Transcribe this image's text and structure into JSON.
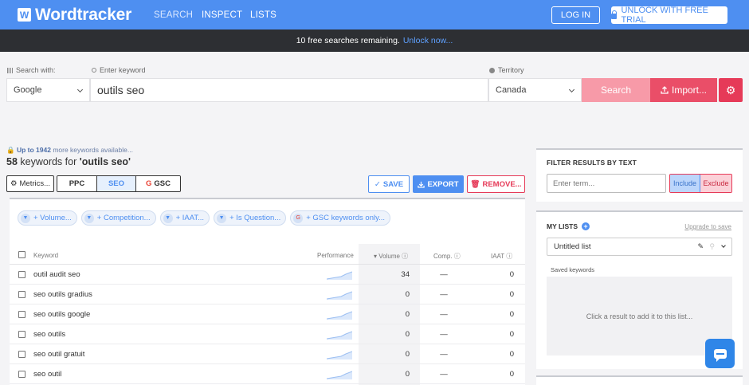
{
  "nav": {
    "logo_letter": "W",
    "logo_text": "Wordtracker",
    "links": [
      "SEARCH",
      "INSPECT",
      "LISTS"
    ],
    "login": "LOG IN",
    "trial": "UNLOCK WITH FREE TRIAL"
  },
  "banner": {
    "text": "10 free searches remaining.",
    "link": "Unlock now..."
  },
  "search": {
    "engine_label": "Search with:",
    "engine_value": "Google",
    "keyword_label": "Enter keyword",
    "keyword_value": "outils seo",
    "territory_label": "Territory",
    "territory_value": "Canada",
    "search_button": "Search",
    "import_button": "Import..."
  },
  "results": {
    "more_prefix": "Up to 1942",
    "more_suffix": "more keywords available...",
    "count": "58",
    "count_middle": "keywords for",
    "query": "'outils seo'",
    "metrics_button": "Metrics...",
    "tabs": [
      "PPC",
      "SEO",
      "GSC"
    ],
    "save": "SAVE",
    "export": "EXPORT",
    "remove": "REMOVE..."
  },
  "filters": [
    "+ Volume...",
    "+ Competition...",
    "+ IAAT...",
    "+ Is Question...",
    "+ GSC keywords only..."
  ],
  "table": {
    "headers": {
      "keyword": "Keyword",
      "performance": "Performance",
      "volume": "Volume",
      "comp": "Comp.",
      "iaat": "IAAT"
    },
    "rows": [
      {
        "keyword": "outil audit seo",
        "volume": "34",
        "comp": "—",
        "iaat": "0"
      },
      {
        "keyword": "seo outils gradius",
        "volume": "0",
        "comp": "—",
        "iaat": "0"
      },
      {
        "keyword": "seo outils google",
        "volume": "0",
        "comp": "—",
        "iaat": "0"
      },
      {
        "keyword": "seo outils",
        "volume": "0",
        "comp": "—",
        "iaat": "0"
      },
      {
        "keyword": "seo outil gratuit",
        "volume": "0",
        "comp": "—",
        "iaat": "0"
      },
      {
        "keyword": "seo outil",
        "volume": "0",
        "comp": "—",
        "iaat": "0"
      }
    ]
  },
  "filter_text": {
    "title": "FILTER RESULTS BY TEXT",
    "placeholder": "Enter term...",
    "include": "Include",
    "exclude": "Exclude"
  },
  "my_lists": {
    "title": "MY LISTS",
    "upgrade": "Upgrade to save",
    "selected": "Untitled list",
    "saved_label": "Saved keywords",
    "empty": "Click a result to add it to this list..."
  },
  "colors": {
    "brand": "#4e8ff1",
    "accent_red": "#e63a58",
    "banner": "#2d2f33"
  }
}
